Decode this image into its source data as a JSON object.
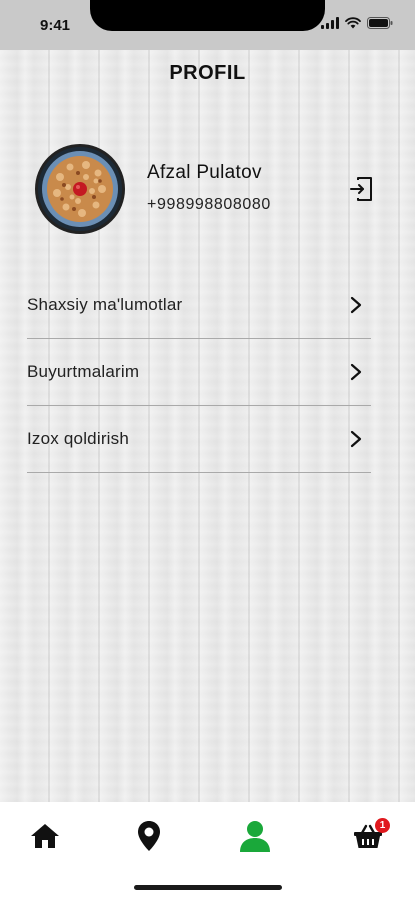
{
  "status_bar": {
    "time": "9:41"
  },
  "header": {
    "title": "PROFIL"
  },
  "profile": {
    "name": "Afzal Pulatov",
    "phone": "+998998808080"
  },
  "menu": {
    "items": [
      {
        "label": "Shaxsiy ma'lumotlar"
      },
      {
        "label": "Buyurtmalarim"
      },
      {
        "label": "Izox qoldirish"
      }
    ]
  },
  "bottom_nav": {
    "items": [
      {
        "icon": "home-icon"
      },
      {
        "icon": "location-pin-icon"
      },
      {
        "icon": "user-icon",
        "active": true
      },
      {
        "icon": "basket-icon",
        "badge": "1"
      }
    ],
    "active_color": "#1aa83a",
    "badge_color": "#e0191e"
  }
}
